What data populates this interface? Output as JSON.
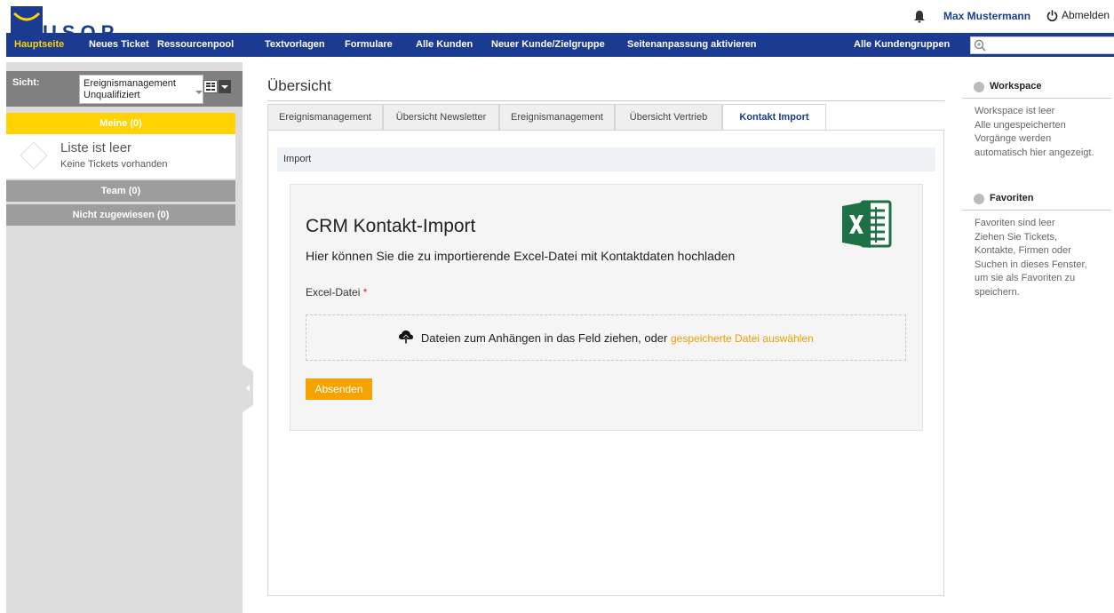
{
  "header": {
    "logo_text": "USOP",
    "user_name": "Max Mustermann",
    "logout_label": "Abmelden"
  },
  "nav": {
    "items": [
      "Hauptseite",
      "Neues Ticket",
      "Ressourcenpool",
      "Textvorlagen",
      "Formulare",
      "Alle Kunden",
      "Neuer Kunde/Zielgruppe",
      "Seitenanpassung aktivieren"
    ],
    "right_item": "Alle Kundengruppen",
    "search_value": "",
    "active_color": "#ffd200",
    "bar_color": "#1b3b93"
  },
  "sidebar": {
    "sicht_label": "Sicht:",
    "sicht_line1": "Ereignismanagement",
    "sicht_line2": "Unqualifiziert",
    "groups": [
      "Meine (0)",
      "Team (0)",
      "Nicht zugewiesen (0)"
    ],
    "empty_title": "Liste ist leer",
    "empty_sub": "Keine Tickets vorhanden"
  },
  "main": {
    "title": "Übersicht",
    "tabs": [
      "Ereignismanagement",
      "Übersicht Newsletter",
      "Ereignismanagement",
      "Übersicht Vertrieb",
      "Kontakt Import"
    ],
    "active_tab": 4,
    "import_bar": "Import",
    "card_title": "CRM Kontakt-Import",
    "card_sub": "Hier können Sie die zu importierende Excel-Datei mit Kontaktdaten hochladen",
    "field_label": "Excel-Datei",
    "required_mark": "*",
    "drop_text": "Dateien zum Anhängen in das Feld ziehen, oder",
    "drop_link": "gespeicherte Datei auswählen",
    "submit_label": "Absenden"
  },
  "right_panel": {
    "workspace_title": "Workspace",
    "workspace_text": [
      "Workspace ist leer",
      "Alle ungespeicherten",
      "Vorgänge werden",
      "automatisch hier angezeigt."
    ],
    "favorites_title": "Favoriten",
    "favorites_text": [
      "Favoriten sind leer",
      "Ziehen Sie Tickets,",
      "Kontakte, Firmen oder",
      "Suchen in dieses Fenster,",
      "um sie als Favoriten zu",
      "speichern."
    ]
  }
}
